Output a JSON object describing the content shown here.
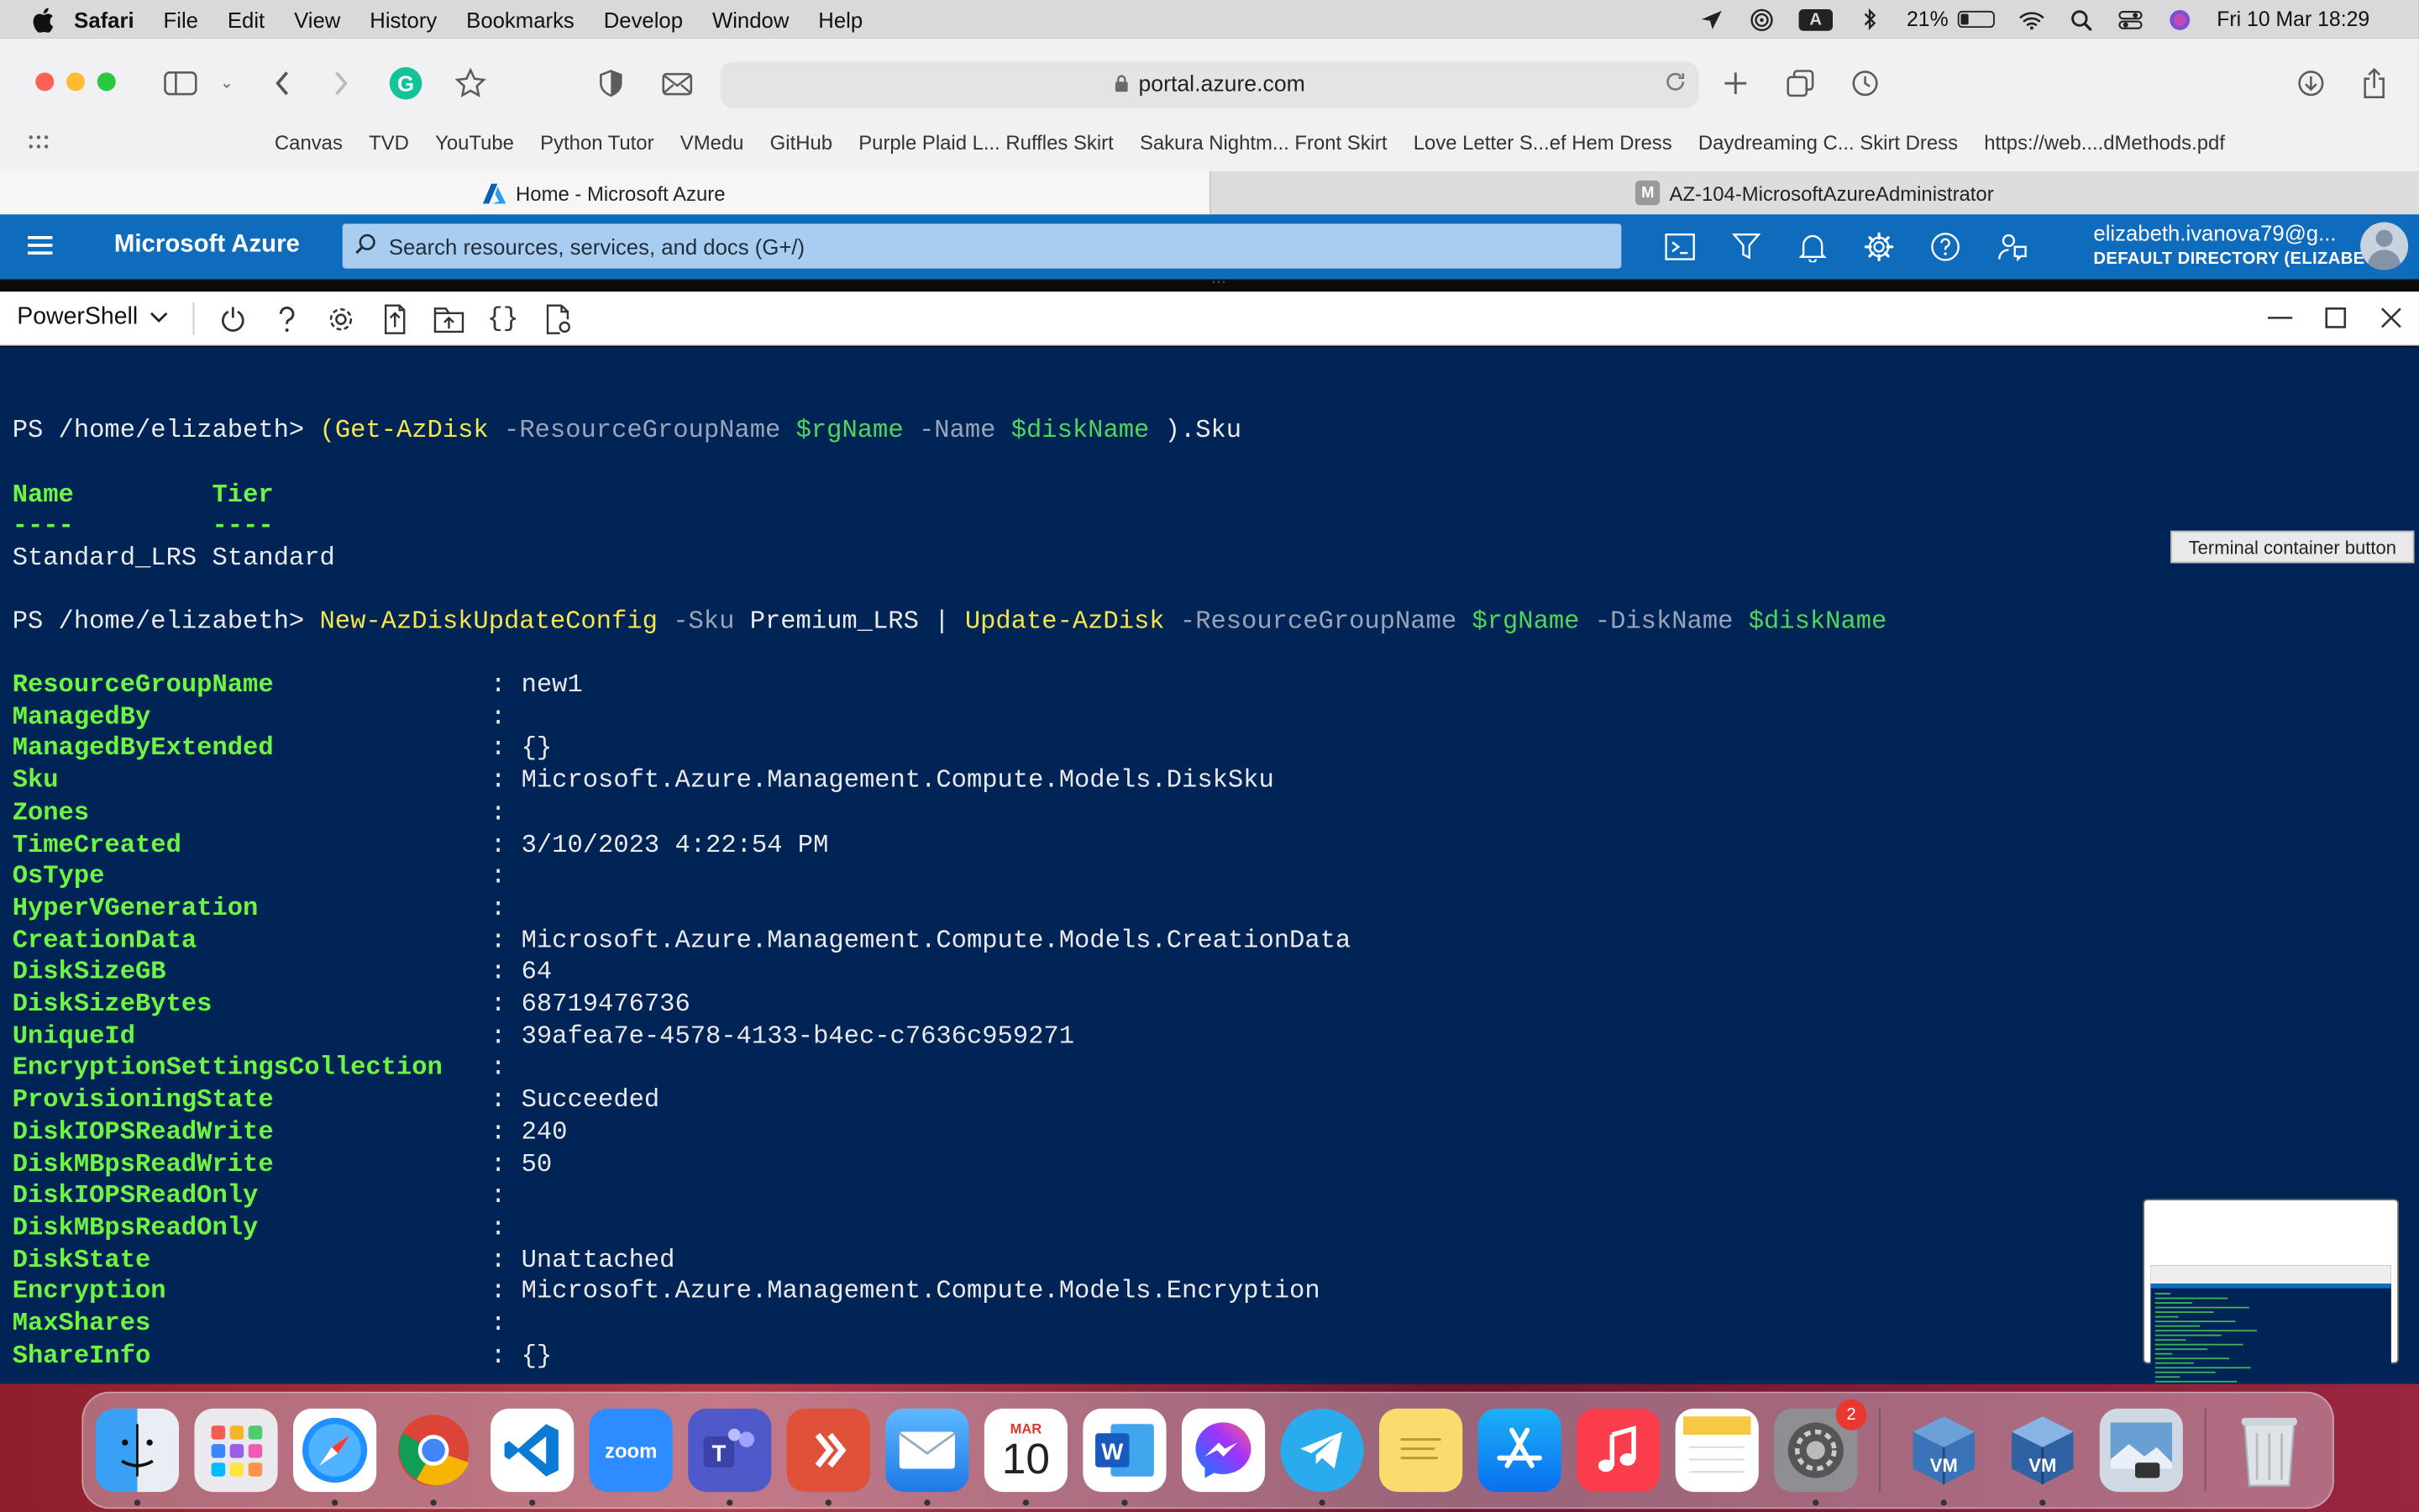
{
  "menubar": {
    "app_name": "Safari",
    "items": [
      "File",
      "Edit",
      "View",
      "History",
      "Bookmarks",
      "Develop",
      "Window",
      "Help"
    ],
    "battery": "21%",
    "input_source": "A",
    "datetime": "Fri 10 Mar  18:29"
  },
  "browser": {
    "url": "portal.azure.com",
    "bookmarks": [
      "Canvas",
      "TVD",
      "YouTube",
      "Python Tutor",
      "VMedu",
      "GitHub",
      "Purple Plaid L... Ruffles Skirt",
      "Sakura Nightm... Front Skirt",
      "Love Letter S...ef Hem Dress",
      "Daydreaming C... Skirt Dress",
      "https://web....dMethods.pdf"
    ],
    "tabs": [
      {
        "title": "Home - Microsoft Azure",
        "active": true
      },
      {
        "title": "AZ-104-MicrosoftAzureAdministrator",
        "active": false,
        "favicon_letter": "M"
      }
    ]
  },
  "azure": {
    "brand": "Microsoft Azure",
    "search_placeholder": "Search resources, services, and docs (G+/)",
    "user_email": "elizabeth.ivanova79@g...",
    "user_directory": "DEFAULT DIRECTORY (ELIZABET...",
    "header_icons": [
      "cloud-shell-icon",
      "directory-filter-icon",
      "notifications-icon",
      "settings-icon",
      "help-icon",
      "feedback-icon"
    ]
  },
  "cloudshell": {
    "shell": "PowerShell",
    "toolbar_icons": [
      "restart-icon",
      "help-icon",
      "settings-icon",
      "upload-download-icon",
      "open-session-icon",
      "editor-icon",
      "web-preview-icon"
    ],
    "tooltip": "Terminal container button",
    "prompt": "PS /home/elizabeth>",
    "cmd1": {
      "open": "(",
      "cmdlet": "Get-AzDisk",
      "p1": "-ResourceGroupName",
      "v1": "$rgName",
      "p2": "-Name",
      "v2": "$diskName",
      "close": ").Sku"
    },
    "sku_table": {
      "headers": [
        "Name",
        "Tier"
      ],
      "dashes": [
        "----",
        "----"
      ],
      "row": [
        "Standard_LRS",
        "Standard"
      ]
    },
    "cmd2": {
      "cmdlet1": "New-AzDiskUpdateConfig",
      "p1": "-Sku",
      "v1": "Premium_LRS",
      "pipe": "|",
      "cmdlet2": "Update-AzDisk",
      "p2": "-ResourceGroupName",
      "v2": "$rgName",
      "p3": "-DiskName",
      "v3": "$diskName"
    },
    "properties": [
      {
        "key": "ResourceGroupName",
        "value": "new1"
      },
      {
        "key": "ManagedBy",
        "value": ""
      },
      {
        "key": "ManagedByExtended",
        "value": "{}"
      },
      {
        "key": "Sku",
        "value": "Microsoft.Azure.Management.Compute.Models.DiskSku"
      },
      {
        "key": "Zones",
        "value": ""
      },
      {
        "key": "TimeCreated",
        "value": "3/10/2023 4:22:54 PM"
      },
      {
        "key": "OsType",
        "value": ""
      },
      {
        "key": "HyperVGeneration",
        "value": ""
      },
      {
        "key": "CreationData",
        "value": "Microsoft.Azure.Management.Compute.Models.CreationData"
      },
      {
        "key": "DiskSizeGB",
        "value": "64"
      },
      {
        "key": "DiskSizeBytes",
        "value": "68719476736"
      },
      {
        "key": "UniqueId",
        "value": "39afea7e-4578-4133-b4ec-c7636c959271"
      },
      {
        "key": "EncryptionSettingsCollection",
        "value": ""
      },
      {
        "key": "ProvisioningState",
        "value": "Succeeded"
      },
      {
        "key": "DiskIOPSReadWrite",
        "value": "240"
      },
      {
        "key": "DiskMBpsReadWrite",
        "value": "50"
      },
      {
        "key": "DiskIOPSReadOnly",
        "value": ""
      },
      {
        "key": "DiskMBpsReadOnly",
        "value": ""
      },
      {
        "key": "DiskState",
        "value": "Unattached"
      },
      {
        "key": "Encryption",
        "value": "Microsoft.Azure.Management.Compute.Models.Encryption"
      },
      {
        "key": "MaxShares",
        "value": ""
      },
      {
        "key": "ShareInfo",
        "value": "{}"
      }
    ]
  },
  "dock": {
    "apps": [
      "finder-icon",
      "launchpad-icon",
      "safari-icon",
      "chrome-icon",
      "vscode-icon",
      "zoom-icon",
      "teams-icon",
      "remote-desktop-icon",
      "mail-icon",
      "calendar-icon",
      "word-icon",
      "messenger-icon",
      "telegram-icon",
      "stickies-icon",
      "app-store-icon",
      "music-icon",
      "notes-icon",
      "system-preferences-icon",
      "virtualbox-icon",
      "virtualbox-vm-icon",
      "preview-icon",
      "trash-icon"
    ],
    "zoom_label": "zoom",
    "calendar_month": "MAR",
    "calendar_day": "10",
    "settings_badge": "2"
  },
  "colors": {
    "azure_blue": "#0f6cbd",
    "terminal_bg": "#012456",
    "cmdlet_yellow": "#f5e64f",
    "variable_green": "#4fd65a",
    "property_green": "#6cf542"
  }
}
